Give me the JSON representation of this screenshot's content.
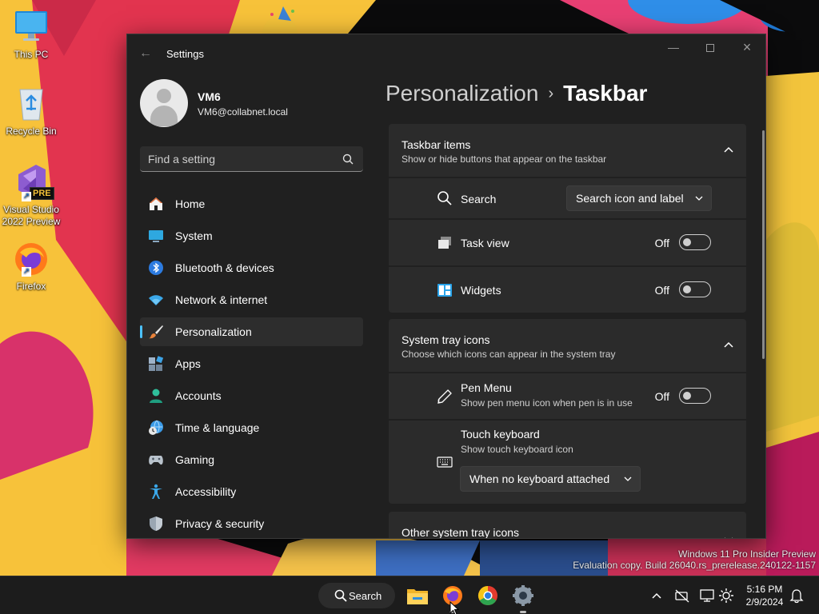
{
  "desktop": {
    "icons": [
      {
        "label": "This PC",
        "icon": "monitor-icon"
      },
      {
        "label": "Recycle Bin",
        "icon": "recycle-bin-icon"
      },
      {
        "label": "Visual Studio 2022 Preview",
        "badge": "PRE",
        "icon": "visual-studio-icon"
      },
      {
        "label": "Firefox",
        "icon": "firefox-icon"
      }
    ],
    "watermark": {
      "line1": "Windows 11 Pro Insider Preview",
      "line2": "Evaluation copy. Build 26040.rs_prerelease.240122-1157"
    }
  },
  "window": {
    "title": "Settings",
    "back_icon": "back-arrow-icon",
    "controls": [
      "minimize-icon",
      "maximize-icon",
      "close-icon"
    ]
  },
  "profile": {
    "name": "VM6",
    "email": "VM6@collabnet.local"
  },
  "search": {
    "placeholder": "Find a setting",
    "value": ""
  },
  "sidebar": {
    "items": [
      {
        "label": "Home",
        "icon": "home-icon",
        "selected": false
      },
      {
        "label": "System",
        "icon": "system-icon",
        "selected": false
      },
      {
        "label": "Bluetooth & devices",
        "icon": "bluetooth-icon",
        "selected": false
      },
      {
        "label": "Network & internet",
        "icon": "wifi-icon",
        "selected": false
      },
      {
        "label": "Personalization",
        "icon": "brush-icon",
        "selected": true
      },
      {
        "label": "Apps",
        "icon": "apps-icon",
        "selected": false
      },
      {
        "label": "Accounts",
        "icon": "accounts-icon",
        "selected": false
      },
      {
        "label": "Time & language",
        "icon": "time-language-icon",
        "selected": false
      },
      {
        "label": "Gaming",
        "icon": "gaming-icon",
        "selected": false
      },
      {
        "label": "Accessibility",
        "icon": "accessibility-icon",
        "selected": false
      },
      {
        "label": "Privacy & security",
        "icon": "shield-icon",
        "selected": false
      }
    ]
  },
  "breadcrumb": {
    "parent": "Personalization",
    "separator": "›",
    "current": "Taskbar"
  },
  "sections": {
    "taskbar_items": {
      "title": "Taskbar items",
      "description": "Show or hide buttons that appear on the taskbar",
      "expanded": true,
      "rows": {
        "search": {
          "label": "Search",
          "icon": "search-icon",
          "dropdown_value": "Search icon and label"
        },
        "task_view": {
          "label": "Task view",
          "icon": "task-view-icon",
          "state_text": "Off",
          "on": false
        },
        "widgets": {
          "label": "Widgets",
          "icon": "widgets-icon",
          "state_text": "Off",
          "on": false
        }
      }
    },
    "system_tray": {
      "title": "System tray icons",
      "description": "Choose which icons can appear in the system tray",
      "expanded": true,
      "rows": {
        "pen_menu": {
          "label": "Pen Menu",
          "sub": "Show pen menu icon when pen is in use",
          "icon": "pen-icon",
          "state_text": "Off",
          "on": false
        },
        "touch_keyboard": {
          "label": "Touch keyboard",
          "sub": "Show touch keyboard icon",
          "icon": "keyboard-icon",
          "dropdown_value": "When no keyboard attached"
        }
      }
    },
    "other_tray": {
      "title": "Other system tray icons",
      "expanded": false
    }
  },
  "taskbar": {
    "search_label": "Search",
    "apps": [
      "file-explorer-icon",
      "firefox-icon",
      "chrome-icon",
      "settings-icon"
    ],
    "tray_icons": [
      "chevron-up-icon",
      "network-off-icon",
      "display-icon",
      "settings-gear-icon",
      "notification-bell-icon"
    ],
    "time": "5:16 PM",
    "date": "2/9/2024"
  },
  "colors": {
    "accent": "#4cc2ff",
    "window_bg": "#202020",
    "card_bg": "#2b2b2b",
    "taskbar_bg": "#1c1c1c"
  }
}
